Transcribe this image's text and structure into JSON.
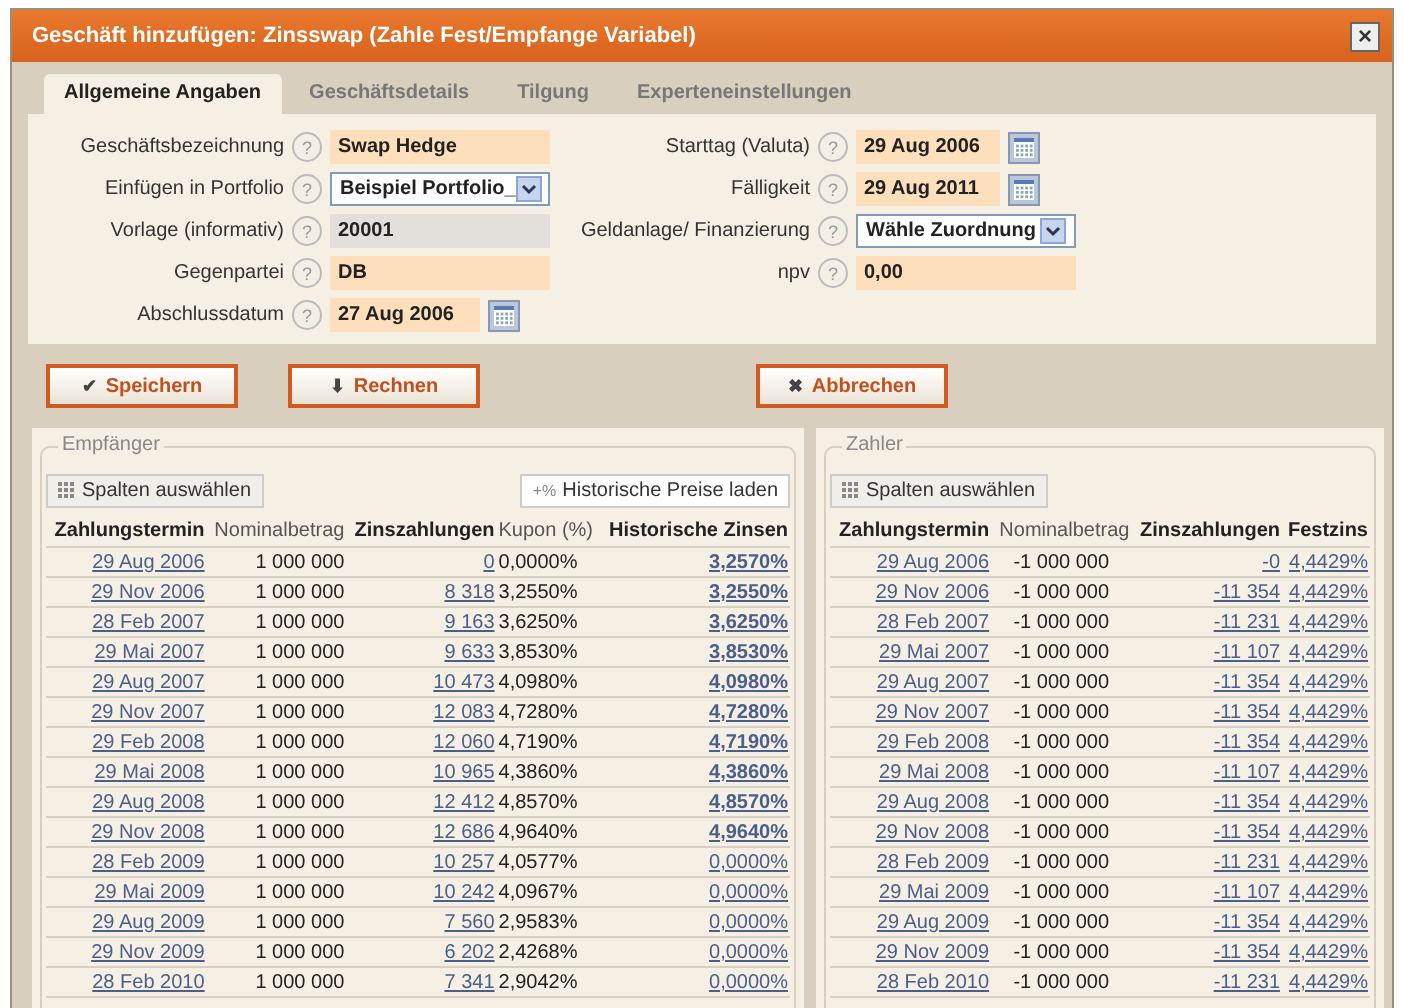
{
  "window": {
    "title": "Geschäft hinzufügen: Zinsswap (Zahle Fest/Empfange Variabel)",
    "close": "×"
  },
  "tabs": [
    {
      "label": "Allgemeine Angaben",
      "selected": true
    },
    {
      "label": "Geschäftsdetails",
      "selected": false
    },
    {
      "label": "Tilgung",
      "selected": false
    },
    {
      "label": "Experteneinstellungen",
      "selected": false
    }
  ],
  "form": {
    "left": [
      {
        "label": "Geschäftsbezeichnung",
        "value": "Swap Hedge",
        "kind": "text"
      },
      {
        "label": "Einfügen in Portfolio",
        "value": "Beispiel Portfolio_",
        "kind": "select"
      },
      {
        "label": "Vorlage (informativ)",
        "value": "20001",
        "kind": "readonly"
      },
      {
        "label": "Gegenpartei",
        "value": "DB",
        "kind": "text"
      },
      {
        "label": "Abschlussdatum",
        "value": "27 Aug 2006",
        "kind": "date"
      }
    ],
    "right": [
      {
        "label": "Starttag (Valuta)",
        "value": "29 Aug 2006",
        "kind": "date"
      },
      {
        "label": "Fälligkeit",
        "value": "29 Aug 2011",
        "kind": "date"
      },
      {
        "label": "Geldanlage/ Finanzierung",
        "value": "Wähle Zuordnung",
        "kind": "select"
      },
      {
        "label": "npv",
        "value": "0,00",
        "kind": "text"
      }
    ],
    "help": "?"
  },
  "buttons": [
    {
      "label": "Speichern",
      "kind": "save",
      "icon": "✔"
    },
    {
      "label": "Rechnen",
      "kind": "calc",
      "icon": "⬇"
    },
    {
      "label": "Abbrechen",
      "kind": "cancel",
      "icon": "✖"
    }
  ],
  "receiver": {
    "legend": "Empfänger",
    "columns_button": "Spalten auswählen",
    "history_button": "Historische Preise laden",
    "history_icon": "+%",
    "columns": [
      "Zahlungstermin",
      "Nominalbetrag",
      "Zinszahlungen",
      "Kupon (%)",
      "Historische Zinsen"
    ],
    "rows": [
      {
        "date": "29 Aug 2006",
        "nominal": "1 000 000",
        "interest": "0",
        "coupon": "0,0000%",
        "historic": "3,2570%",
        "loaded": true
      },
      {
        "date": "29 Nov 2006",
        "nominal": "1 000 000",
        "interest": "8 318",
        "coupon": "3,2550%",
        "historic": "3,2550%",
        "loaded": true
      },
      {
        "date": "28 Feb 2007",
        "nominal": "1 000 000",
        "interest": "9 163",
        "coupon": "3,6250%",
        "historic": "3,6250%",
        "loaded": true
      },
      {
        "date": "29 Mai 2007",
        "nominal": "1 000 000",
        "interest": "9 633",
        "coupon": "3,8530%",
        "historic": "3,8530%",
        "loaded": true
      },
      {
        "date": "29 Aug 2007",
        "nominal": "1 000 000",
        "interest": "10 473",
        "coupon": "4,0980%",
        "historic": "4,0980%",
        "loaded": true
      },
      {
        "date": "29 Nov 2007",
        "nominal": "1 000 000",
        "interest": "12 083",
        "coupon": "4,7280%",
        "historic": "4,7280%",
        "loaded": true
      },
      {
        "date": "29 Feb 2008",
        "nominal": "1 000 000",
        "interest": "12 060",
        "coupon": "4,7190%",
        "historic": "4,7190%",
        "loaded": true
      },
      {
        "date": "29 Mai 2008",
        "nominal": "1 000 000",
        "interest": "10 965",
        "coupon": "4,3860%",
        "historic": "4,3860%",
        "loaded": true
      },
      {
        "date": "29 Aug 2008",
        "nominal": "1 000 000",
        "interest": "12 412",
        "coupon": "4,8570%",
        "historic": "4,8570%",
        "loaded": true
      },
      {
        "date": "29 Nov 2008",
        "nominal": "1 000 000",
        "interest": "12 686",
        "coupon": "4,9640%",
        "historic": "4,9640%",
        "loaded": true
      },
      {
        "date": "28 Feb 2009",
        "nominal": "1 000 000",
        "interest": "10 257",
        "coupon": "4,0577%",
        "historic": "0,0000%",
        "loaded": false
      },
      {
        "date": "29 Mai 2009",
        "nominal": "1 000 000",
        "interest": "10 242",
        "coupon": "4,0967%",
        "historic": "0,0000%",
        "loaded": false
      },
      {
        "date": "29 Aug 2009",
        "nominal": "1 000 000",
        "interest": "7 560",
        "coupon": "2,9583%",
        "historic": "0,0000%",
        "loaded": false
      },
      {
        "date": "29 Nov 2009",
        "nominal": "1 000 000",
        "interest": "6 202",
        "coupon": "2,4268%",
        "historic": "0,0000%",
        "loaded": false
      },
      {
        "date": "28 Feb 2010",
        "nominal": "1 000 000",
        "interest": "7 341",
        "coupon": "2,9042%",
        "historic": "0,0000%",
        "loaded": false
      }
    ]
  },
  "payer": {
    "legend": "Zahler",
    "columns_button": "Spalten auswählen",
    "columns": [
      "Zahlungstermin",
      "Nominalbetrag",
      "Zinszahlungen",
      "Festzins"
    ],
    "rows": [
      {
        "date": "29 Aug 2006",
        "nominal": "-1 000 000",
        "interest": "-0",
        "rate": "4,4429%"
      },
      {
        "date": "29 Nov 2006",
        "nominal": "-1 000 000",
        "interest": "-11 354",
        "rate": "4,4429%"
      },
      {
        "date": "28 Feb 2007",
        "nominal": "-1 000 000",
        "interest": "-11 231",
        "rate": "4,4429%"
      },
      {
        "date": "29 Mai 2007",
        "nominal": "-1 000 000",
        "interest": "-11 107",
        "rate": "4,4429%"
      },
      {
        "date": "29 Aug 2007",
        "nominal": "-1 000 000",
        "interest": "-11 354",
        "rate": "4,4429%"
      },
      {
        "date": "29 Nov 2007",
        "nominal": "-1 000 000",
        "interest": "-11 354",
        "rate": "4,4429%"
      },
      {
        "date": "29 Feb 2008",
        "nominal": "-1 000 000",
        "interest": "-11 354",
        "rate": "4,4429%"
      },
      {
        "date": "29 Mai 2008",
        "nominal": "-1 000 000",
        "interest": "-11 107",
        "rate": "4,4429%"
      },
      {
        "date": "29 Aug 2008",
        "nominal": "-1 000 000",
        "interest": "-11 354",
        "rate": "4,4429%"
      },
      {
        "date": "29 Nov 2008",
        "nominal": "-1 000 000",
        "interest": "-11 354",
        "rate": "4,4429%"
      },
      {
        "date": "28 Feb 2009",
        "nominal": "-1 000 000",
        "interest": "-11 231",
        "rate": "4,4429%"
      },
      {
        "date": "29 Mai 2009",
        "nominal": "-1 000 000",
        "interest": "-11 107",
        "rate": "4,4429%"
      },
      {
        "date": "29 Aug 2009",
        "nominal": "-1 000 000",
        "interest": "-11 354",
        "rate": "4,4429%"
      },
      {
        "date": "29 Nov 2009",
        "nominal": "-1 000 000",
        "interest": "-11 354",
        "rate": "4,4429%"
      },
      {
        "date": "28 Feb 2010",
        "nominal": "-1 000 000",
        "interest": "-11 231",
        "rate": "4,4429%"
      }
    ]
  }
}
